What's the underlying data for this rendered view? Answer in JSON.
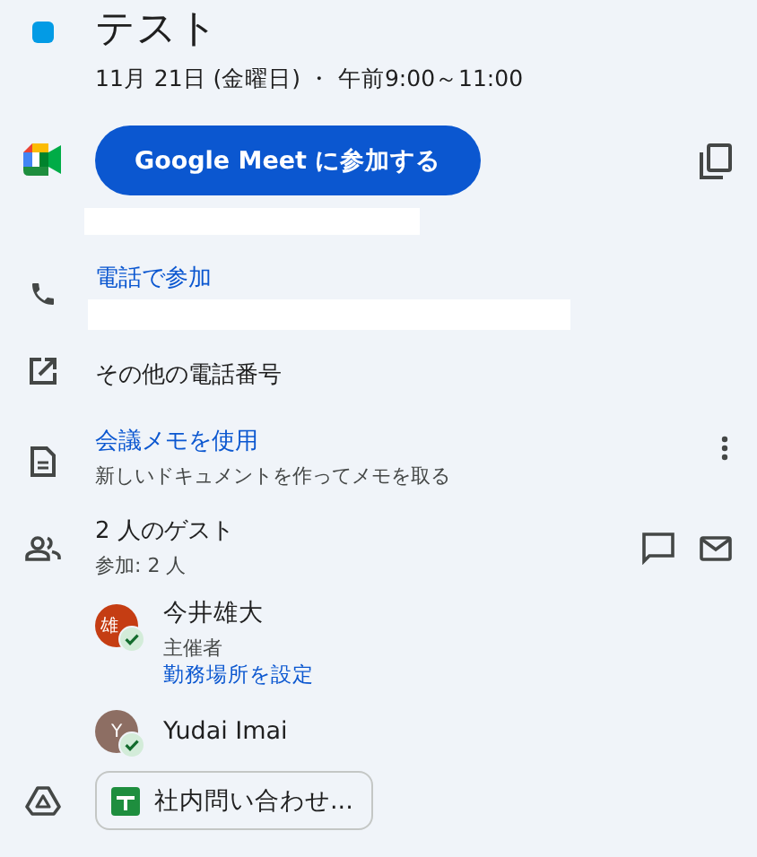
{
  "event": {
    "title": "テスト",
    "color": "#039be5",
    "datetime": "11月 21日 (金曜日) ・ 午前9:00～11:00"
  },
  "meet": {
    "button": "Google Meet に参加する"
  },
  "phone": {
    "link": "電話で参加"
  },
  "other_numbers": {
    "label": "その他の電話番号"
  },
  "notes": {
    "link": "会議メモを使用",
    "subtitle": "新しいドキュメントを作ってメモを取る"
  },
  "guests": {
    "title": "2 人のゲスト",
    "subtitle": "参加: 2 人",
    "people": [
      {
        "initials": "雄",
        "color": "#c53d13",
        "name": "今井雄大",
        "role": "主催者",
        "link": "勤務場所を設定",
        "accepted": true
      },
      {
        "initials": "Y",
        "color": "#8d6e63",
        "name": "Yudai Imai",
        "accepted": true
      }
    ]
  },
  "attachments": [
    {
      "label": "社内問い合わせ..."
    }
  ]
}
